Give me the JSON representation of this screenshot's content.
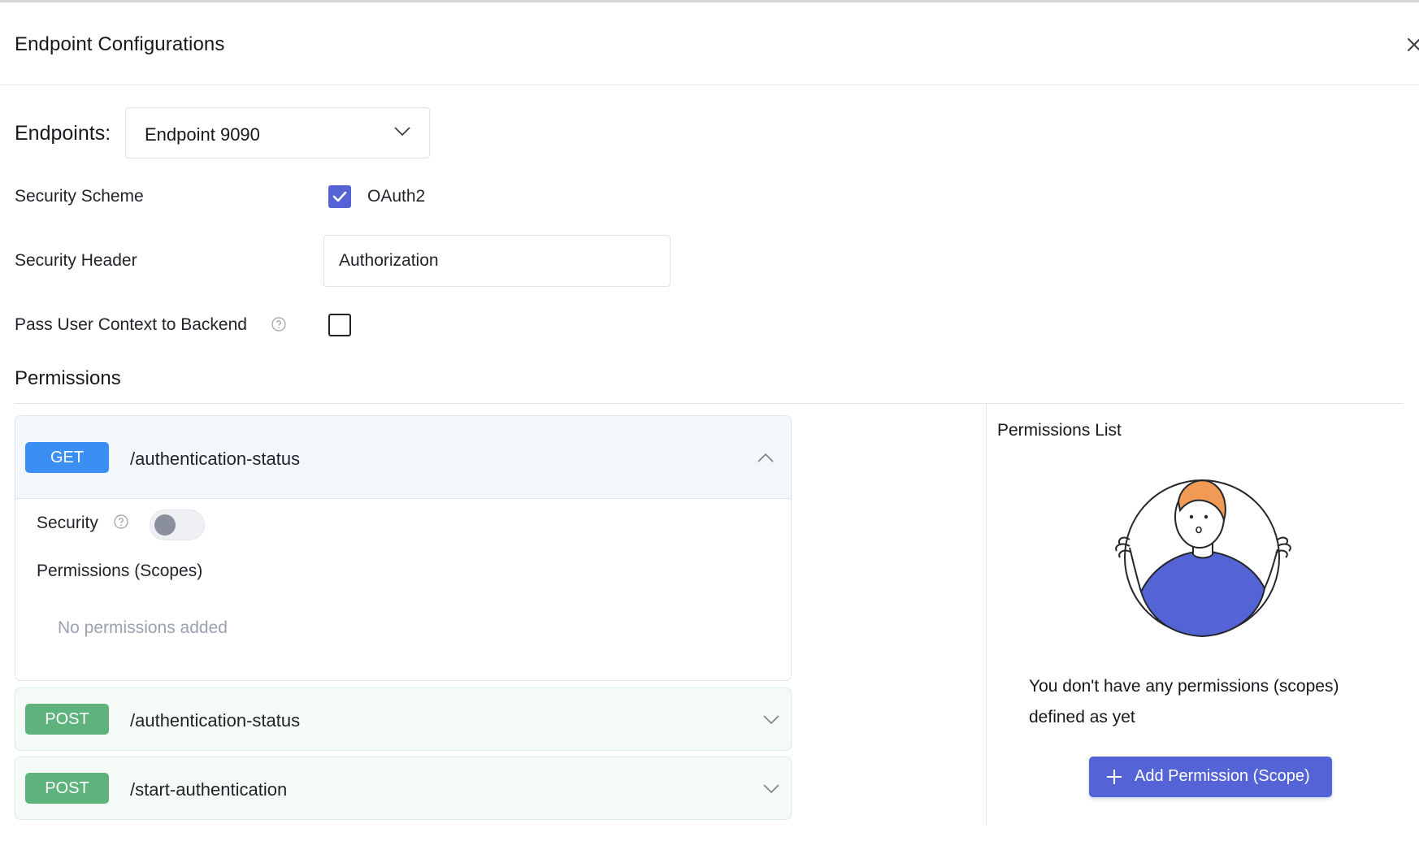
{
  "dialog": {
    "title": "Endpoint Configurations"
  },
  "endpoints": {
    "label": "Endpoints:",
    "selected": "Endpoint 9090"
  },
  "security_scheme": {
    "label": "Security Scheme",
    "option_label": "OAuth2",
    "checked": true
  },
  "security_header": {
    "label": "Security Header",
    "value": "Authorization"
  },
  "pass_user_context": {
    "label": "Pass User Context to Backend",
    "checked": false
  },
  "permissions": {
    "title": "Permissions",
    "resources": [
      {
        "method": "GET",
        "path": "/authentication-status",
        "expanded": true,
        "security_label": "Security",
        "security_enabled": false,
        "scopes_label": "Permissions (Scopes)",
        "empty_message": "No permissions added"
      },
      {
        "method": "POST",
        "path": "/authentication-status",
        "expanded": false
      },
      {
        "method": "POST",
        "path": "/start-authentication",
        "expanded": false
      }
    ]
  },
  "permissions_list": {
    "title": "Permissions List",
    "empty_message": "You don't have any permissions (scopes) defined as yet",
    "add_button_label": "Add Permission (Scope)"
  },
  "colors": {
    "primary": "#5464d6",
    "get_badge": "#3b8ff2",
    "post_badge": "#5eb27b"
  }
}
